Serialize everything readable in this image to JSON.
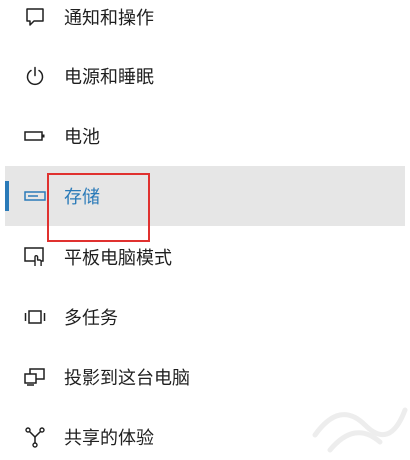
{
  "nav": {
    "items": [
      {
        "label": "通知和操作",
        "icon": "notification-icon",
        "selected": false
      },
      {
        "label": "电源和睡眠",
        "icon": "power-icon",
        "selected": false
      },
      {
        "label": "电池",
        "icon": "battery-icon",
        "selected": false
      },
      {
        "label": "存储",
        "icon": "storage-icon",
        "selected": true
      },
      {
        "label": "平板电脑模式",
        "icon": "tablet-mode-icon",
        "selected": false
      },
      {
        "label": "多任务",
        "icon": "multitasking-icon",
        "selected": false
      },
      {
        "label": "投影到这台电脑",
        "icon": "projecting-icon",
        "selected": false
      },
      {
        "label": "共享的体验",
        "icon": "shared-experiences-icon",
        "selected": false
      }
    ]
  },
  "colors": {
    "accent": "#2a7ab8",
    "selected_background": "#e6e6e6",
    "highlight_box": "#e0312f",
    "text": "#1f1f1f"
  }
}
